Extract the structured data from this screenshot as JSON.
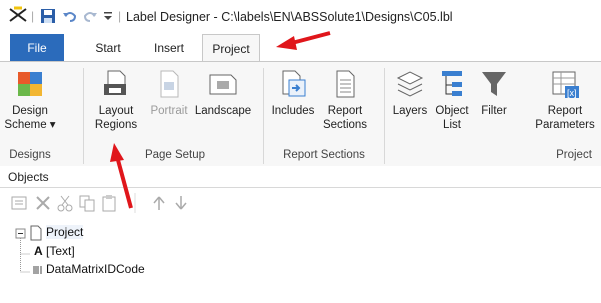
{
  "window": {
    "title": "Label Designer - C:\\labels\\EN\\ABSSolute1\\Designs\\C05.lbl",
    "separator": "|"
  },
  "tabs": [
    {
      "label": "File",
      "active": false
    },
    {
      "label": "Start",
      "active": false
    },
    {
      "label": "Insert",
      "active": false
    },
    {
      "label": "Project",
      "active": true
    }
  ],
  "ribbon": {
    "groups": [
      {
        "label": "Designs",
        "buttons": [
          {
            "label": "Design",
            "label2": "Scheme ▾",
            "icon": "design-scheme-icon"
          }
        ]
      },
      {
        "label": "Page Setup",
        "buttons": [
          {
            "label": "Layout",
            "label2": "Regions",
            "icon": "layout-regions-icon"
          },
          {
            "label": "Portrait",
            "label2": "",
            "icon": "portrait-icon",
            "disabled": true
          },
          {
            "label": "Landscape",
            "label2": "",
            "icon": "landscape-icon"
          }
        ]
      },
      {
        "label": "Report Sections",
        "buttons": [
          {
            "label": "Includes",
            "label2": "",
            "icon": "includes-icon"
          },
          {
            "label": "Report",
            "label2": "Sections",
            "icon": "report-sections-icon"
          }
        ]
      },
      {
        "label": "Project",
        "buttons": [
          {
            "label": "Layers",
            "label2": "",
            "icon": "layers-icon"
          },
          {
            "label": "Object",
            "label2": "List",
            "icon": "object-list-icon"
          },
          {
            "label": "Filter",
            "label2": "",
            "icon": "filter-icon"
          },
          {
            "label": "Report",
            "label2": "Parameters",
            "icon": "report-parameters-icon"
          }
        ]
      }
    ]
  },
  "objects_panel": {
    "title": "Objects",
    "toolbar_icons": [
      "properties-icon",
      "delete-icon",
      "cut-icon",
      "copy-icon",
      "paste-icon",
      "move-up-icon",
      "move-down-icon"
    ],
    "tree": {
      "root": "Project",
      "children": [
        {
          "label": "[Text]",
          "prefix": "A"
        },
        {
          "label": "DataMatrixIDCode",
          "prefix": "barcode"
        }
      ]
    }
  },
  "colors": {
    "file_tab": "#2b6bbb",
    "annotation_arrow": "#e0161b",
    "ribbon_bg": "#f7f7f7"
  }
}
